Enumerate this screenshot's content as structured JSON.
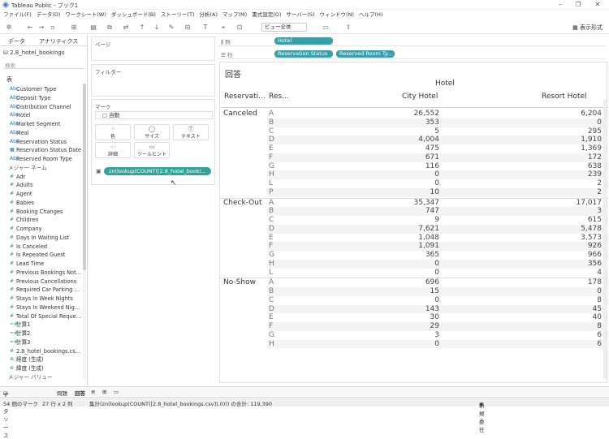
{
  "app": {
    "title": "Tableau Public - ブック1"
  },
  "menu": [
    "ファイル(F)",
    "データ(D)",
    "ワークシート(W)",
    "ダッシュボード(B)",
    "ストーリー(T)",
    "分析(A)",
    "マップ(M)",
    "書式設定(O)",
    "サーバー(S)",
    "ウィンドウ(N)",
    "ヘルプ(H)"
  ],
  "toolbar": {
    "fit_select": "ビュー全体",
    "present_label": "表示形式"
  },
  "left": {
    "tab_data": "データ",
    "tab_analytics": "アナリティクス",
    "datasource": "2.8_hotel_bookings",
    "search_placeholder": "検索",
    "table_header": "表",
    "fields": [
      {
        "name": "Customer Type",
        "kind": "dim",
        "icon": "Abc"
      },
      {
        "name": "Deposit Type",
        "kind": "dim",
        "icon": "Abc"
      },
      {
        "name": "Distribution Channel",
        "kind": "dim",
        "icon": "Abc"
      },
      {
        "name": "Hotel",
        "kind": "dim",
        "icon": "Abc"
      },
      {
        "name": "Market Segment",
        "kind": "dim",
        "icon": "Abc"
      },
      {
        "name": "Meal",
        "kind": "dim",
        "icon": "Abc"
      },
      {
        "name": "Reservation Status",
        "kind": "dim",
        "icon": "Abc"
      },
      {
        "name": "Reservation Status Date",
        "kind": "dim",
        "icon": "▦"
      },
      {
        "name": "Reserved Room Type",
        "kind": "dim",
        "icon": "Abc"
      },
      {
        "name": "メジャー ネーム",
        "kind": "sec",
        "icon": ""
      },
      {
        "name": "Adr",
        "kind": "mea",
        "icon": "#"
      },
      {
        "name": "Adults",
        "kind": "mea",
        "icon": "#"
      },
      {
        "name": "Agent",
        "kind": "mea",
        "icon": "#"
      },
      {
        "name": "Babies",
        "kind": "mea",
        "icon": "#"
      },
      {
        "name": "Booking Changes",
        "kind": "mea",
        "icon": "#"
      },
      {
        "name": "Children",
        "kind": "mea",
        "icon": "#"
      },
      {
        "name": "Company",
        "kind": "mea",
        "icon": "#"
      },
      {
        "name": "Days In Waiting List",
        "kind": "mea",
        "icon": "#"
      },
      {
        "name": "Is Canceled",
        "kind": "mea",
        "icon": "#"
      },
      {
        "name": "Is Repeated Guest",
        "kind": "mea",
        "icon": "#"
      },
      {
        "name": "Lead Time",
        "kind": "mea",
        "icon": "#"
      },
      {
        "name": "Previous Bookings Not…",
        "kind": "mea",
        "icon": "#"
      },
      {
        "name": "Previous Cancellations",
        "kind": "mea",
        "icon": "#"
      },
      {
        "name": "Required Car Parking …",
        "kind": "mea",
        "icon": "#"
      },
      {
        "name": "Stays In Week Nights",
        "kind": "mea",
        "icon": "#"
      },
      {
        "name": "Stays In Weekend Nig…",
        "kind": "mea",
        "icon": "#"
      },
      {
        "name": "Total Of Special Reque…",
        "kind": "mea",
        "icon": "#"
      },
      {
        "name": "計算1",
        "kind": "mea",
        "icon": "=#"
      },
      {
        "name": "計算2",
        "kind": "mea",
        "icon": "=#"
      },
      {
        "name": "計算3",
        "kind": "mea",
        "icon": "=#"
      },
      {
        "name": "2.8_hotel_bookings.cs…",
        "kind": "mea",
        "icon": "#"
      },
      {
        "name": "経度 (生成)",
        "kind": "mea",
        "icon": "⊕"
      },
      {
        "name": "緯度 (生成)",
        "kind": "mea",
        "icon": "⊕"
      },
      {
        "name": "メジャー バリュー",
        "kind": "sec",
        "icon": ""
      }
    ]
  },
  "cards": {
    "pages": "ページ",
    "filters": "フィルター",
    "marks": "マーク",
    "mark_type": "自動",
    "buttons": [
      {
        "icon": "⁘",
        "label": "色"
      },
      {
        "icon": "◯",
        "label": "サイズ"
      },
      {
        "icon": "Ⓣ",
        "label": "テキスト"
      },
      {
        "icon": "⋯",
        "label": "詳細"
      },
      {
        "icon": "▭",
        "label": "ツールヒント"
      }
    ],
    "text_pill": "zn(lookup(COUNT([2.8_hotel_booki..."
  },
  "shelves": {
    "columns_label": "列",
    "rows_label": "行",
    "columns": [
      "Hotel"
    ],
    "rows": [
      "Reservation Status",
      "Reserved Room Ty..."
    ]
  },
  "view": {
    "title": "回答",
    "col_group_header": "Hotel",
    "row_header_1": "Reservati...",
    "row_header_2": "Res...",
    "columns": [
      "City Hotel",
      "Resort Hotel"
    ],
    "groups": [
      {
        "name": "Canceled",
        "rows": [
          {
            "room": "A",
            "city": "26,552",
            "resort": "6,204"
          },
          {
            "room": "B",
            "city": "353",
            "resort": "0"
          },
          {
            "room": "C",
            "city": "5",
            "resort": "295"
          },
          {
            "room": "D",
            "city": "4,004",
            "resort": "1,910"
          },
          {
            "room": "E",
            "city": "475",
            "resort": "1,369"
          },
          {
            "room": "F",
            "city": "671",
            "resort": "172"
          },
          {
            "room": "G",
            "city": "116",
            "resort": "638"
          },
          {
            "room": "H",
            "city": "0",
            "resort": "239"
          },
          {
            "room": "L",
            "city": "0",
            "resort": "2"
          },
          {
            "room": "P",
            "city": "10",
            "resort": "2"
          }
        ]
      },
      {
        "name": "Check-Out",
        "rows": [
          {
            "room": "A",
            "city": "35,347",
            "resort": "17,017"
          },
          {
            "room": "B",
            "city": "747",
            "resort": "3"
          },
          {
            "room": "C",
            "city": "9",
            "resort": "615"
          },
          {
            "room": "D",
            "city": "7,621",
            "resort": "5,478"
          },
          {
            "room": "E",
            "city": "1,048",
            "resort": "3,573"
          },
          {
            "room": "F",
            "city": "1,091",
            "resort": "926"
          },
          {
            "room": "G",
            "city": "365",
            "resort": "966"
          },
          {
            "room": "H",
            "city": "0",
            "resort": "356"
          },
          {
            "room": "L",
            "city": "0",
            "resort": "4"
          }
        ]
      },
      {
        "name": "No-Show",
        "rows": [
          {
            "room": "A",
            "city": "696",
            "resort": "178"
          },
          {
            "room": "B",
            "city": "15",
            "resort": "0"
          },
          {
            "room": "C",
            "city": "0",
            "resort": "8"
          },
          {
            "room": "D",
            "city": "143",
            "resort": "45"
          },
          {
            "room": "E",
            "city": "30",
            "resort": "40"
          },
          {
            "room": "F",
            "city": "29",
            "resort": "8"
          },
          {
            "room": "G",
            "city": "3",
            "resort": "6"
          },
          {
            "room": "H",
            "city": "0",
            "resort": "6"
          }
        ]
      }
    ]
  },
  "sheet_tabs": {
    "datasource": "データ ソース",
    "sheet1": "問題",
    "sheet2": "回答"
  },
  "status": {
    "marks": "54 個のマーク",
    "dims": "27 行 x 2 列",
    "sum": "集計(zn(lookup(COUNT([2.8_hotel_bookings.csv]),0))) の合計: 119,390",
    "user": "新規委任"
  }
}
